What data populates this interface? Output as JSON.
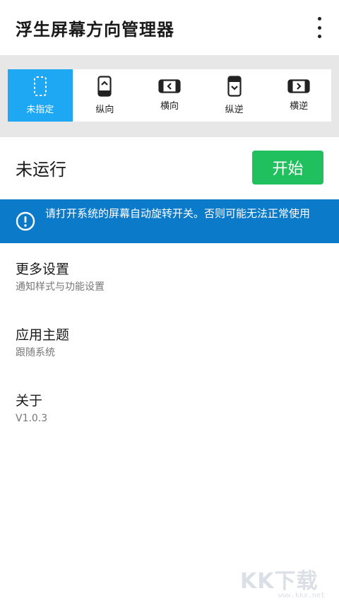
{
  "app": {
    "title": "浮生屏幕方向管理器"
  },
  "header": {
    "more_icon": "more-vert-icon"
  },
  "orientations": [
    {
      "label": "未指定",
      "icon": "unspecified-icon",
      "active": true
    },
    {
      "label": "纵向",
      "icon": "portrait-icon",
      "active": false
    },
    {
      "label": "横向",
      "icon": "landscape-icon",
      "active": false
    },
    {
      "label": "纵逆",
      "icon": "reverse-portrait-icon",
      "active": false
    },
    {
      "label": "横逆",
      "icon": "reverse-landscape-icon",
      "active": false
    }
  ],
  "status": {
    "text": "未运行",
    "button_label": "开始"
  },
  "notice": {
    "text": "请打开系统的屏幕自动旋转开关。否则可能无法正常使用",
    "icon": "info-icon"
  },
  "settings": [
    {
      "title": "更多设置",
      "subtitle": "通知样式与功能设置"
    },
    {
      "title": "应用主题",
      "subtitle": "跟随系统"
    },
    {
      "title": "关于",
      "subtitle": "V1.0.3"
    }
  ],
  "watermark": {
    "text": "KK下载",
    "url": "www.kkx.net"
  },
  "colors": {
    "accent": "#1ea7f3",
    "start_button": "#21c05e",
    "notice_bg": "#0b7ac9",
    "divider_area": "#e7e7e7"
  }
}
